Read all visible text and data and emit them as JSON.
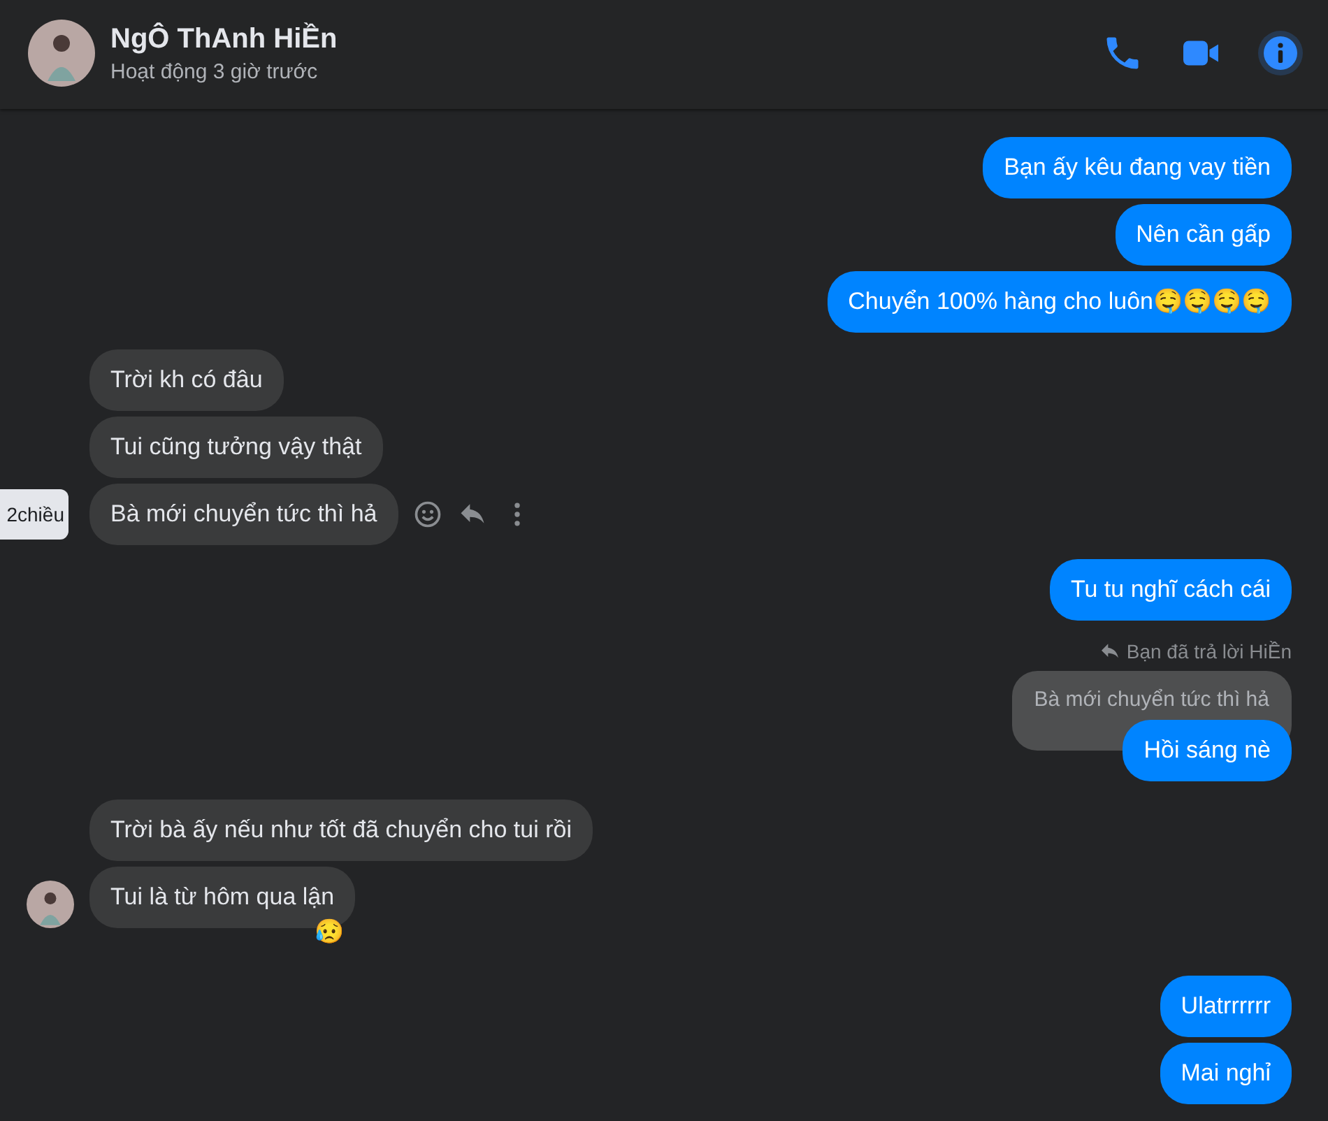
{
  "header": {
    "name": "NgÔ ThAnh HiỀn",
    "status": "Hoạt động 3 giờ trước"
  },
  "groups": [
    {
      "kind": "sent",
      "messages": [
        {
          "kind": "text",
          "text": "Bạn ấy kêu đang vay tiền"
        },
        {
          "kind": "text",
          "text": "Nên cần gấp"
        },
        {
          "kind": "text",
          "text": "Chuyển 100% hàng cho luôn🤤🤤🤤🤤"
        }
      ]
    },
    {
      "kind": "received",
      "messages": [
        {
          "kind": "text",
          "text": "Trời kh có đâu"
        },
        {
          "kind": "text",
          "text": "Tui cũng tưởng vậy thật"
        },
        {
          "kind": "text",
          "text": "Bà mới chuyển tức thì hả",
          "hovered": true,
          "time_tooltip": "2chiều"
        }
      ]
    },
    {
      "kind": "sent",
      "messages": [
        {
          "kind": "text",
          "text": "Tu tu nghĩ cách cái"
        }
      ]
    },
    {
      "kind": "sent",
      "messages": [
        {
          "kind": "reply",
          "reply_label": "Bạn đã trả lời HiỀn",
          "quoted": "Bà mới chuyển tức thì hả",
          "text": "Hồi sáng nè"
        }
      ]
    },
    {
      "kind": "received",
      "avatar": true,
      "messages": [
        {
          "kind": "text",
          "text": "Trời bà ấy nếu như tốt đã chuyển cho tui rồi"
        },
        {
          "kind": "text",
          "text": "Tui là từ hôm qua lận",
          "reaction": "😥"
        }
      ]
    },
    {
      "kind": "sent",
      "messages": [
        {
          "kind": "text",
          "text": "Ulatrrrrrr"
        },
        {
          "kind": "text",
          "text": "Mai nghỉ"
        }
      ]
    }
  ]
}
